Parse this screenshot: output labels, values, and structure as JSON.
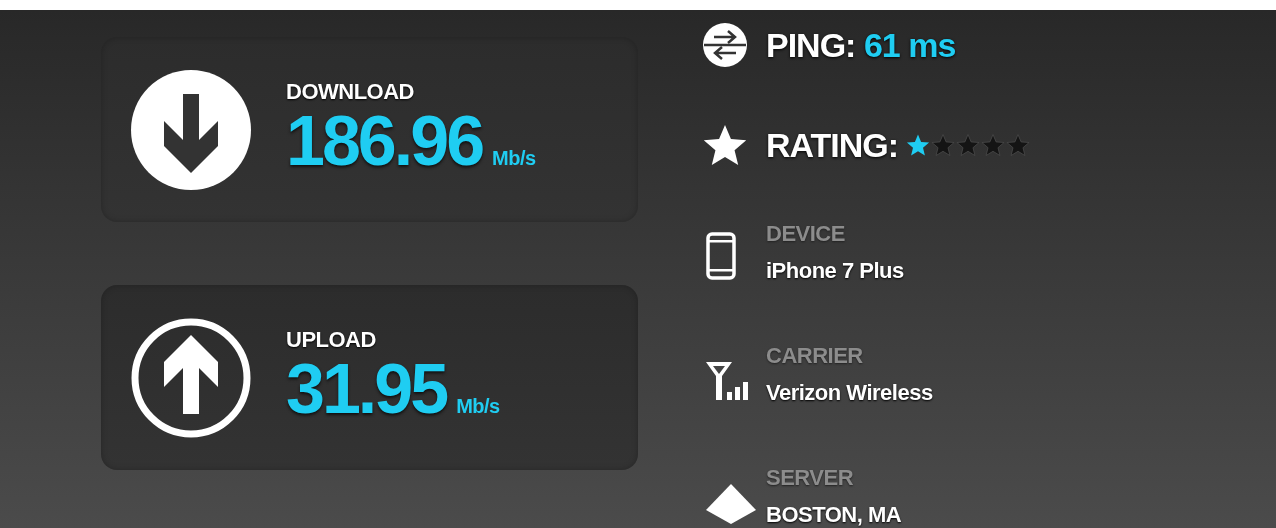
{
  "speeds": [
    {
      "kind": "download",
      "label": "DOWNLOAD",
      "value": "186.96",
      "unit": "Mb/s"
    },
    {
      "kind": "upload",
      "label": "UPLOAD",
      "value": "31.95",
      "unit": "Mb/s"
    }
  ],
  "ping": {
    "label": "PING:",
    "value": "61 ms"
  },
  "rating": {
    "label": "RATING:",
    "stars": 1
  },
  "details": [
    {
      "kind": "device",
      "label": "DEVICE",
      "value": "iPhone 7 Plus"
    },
    {
      "kind": "carrier",
      "label": "CARRIER",
      "value": "Verizon Wireless"
    },
    {
      "kind": "server",
      "label": "SERVER",
      "value": "BOSTON, MA"
    }
  ]
}
